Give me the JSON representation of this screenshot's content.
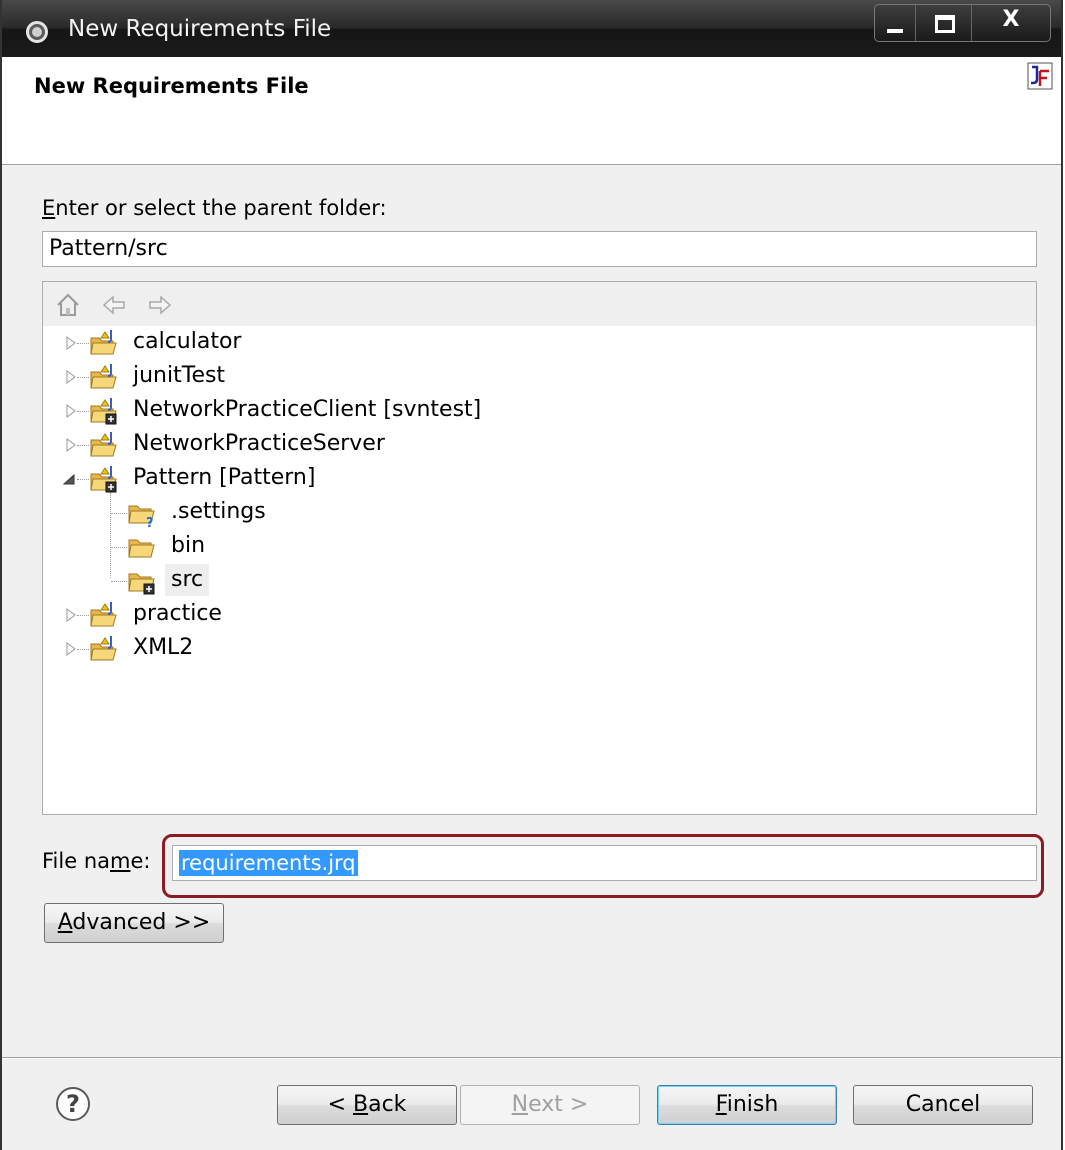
{
  "window": {
    "title": "New Requirements File",
    "close_glyph": "X"
  },
  "header": {
    "title": "New Requirements File",
    "icon": "jf-wizard-banner-icon"
  },
  "parent_folder": {
    "label_mnemonic": "E",
    "label_rest": "nter or select the parent folder:",
    "value": "Pattern/src"
  },
  "tree_toolbar": {
    "icons": [
      "home-icon",
      "back-arrow-icon",
      "forward-arrow-icon"
    ]
  },
  "tree": {
    "items": [
      {
        "label": "calculator",
        "expanded": false,
        "level": 0
      },
      {
        "label": "junitTest",
        "expanded": false,
        "level": 0
      },
      {
        "label": "NetworkPracticeClient [svntest]",
        "expanded": false,
        "level": 0
      },
      {
        "label": "NetworkPracticeServer",
        "expanded": false,
        "level": 0
      },
      {
        "label": "Pattern [Pattern]",
        "expanded": true,
        "level": 0
      },
      {
        "label": ".settings",
        "level": 1
      },
      {
        "label": "bin",
        "level": 1
      },
      {
        "label": "src",
        "level": 1,
        "selected": true
      },
      {
        "label": "practice",
        "expanded": false,
        "level": 0
      },
      {
        "label": "XML2",
        "expanded": false,
        "level": 0
      }
    ]
  },
  "file_name": {
    "label_pre": "File na",
    "label_mnemonic": "m",
    "label_post": "e:",
    "value": "requirements.jrq"
  },
  "advanced": {
    "mnemonic": "A",
    "rest": "dvanced >>"
  },
  "buttons": {
    "help": "?",
    "back_pre": "< ",
    "back_mnemonic": "B",
    "back_rest": "ack",
    "next_mnemonic": "N",
    "next_rest": "ext >",
    "finish_mnemonic": "F",
    "finish_rest": "inish",
    "cancel": "Cancel"
  },
  "colors": {
    "selection": "#3399ff",
    "highlight_border": "#8b1c25"
  }
}
